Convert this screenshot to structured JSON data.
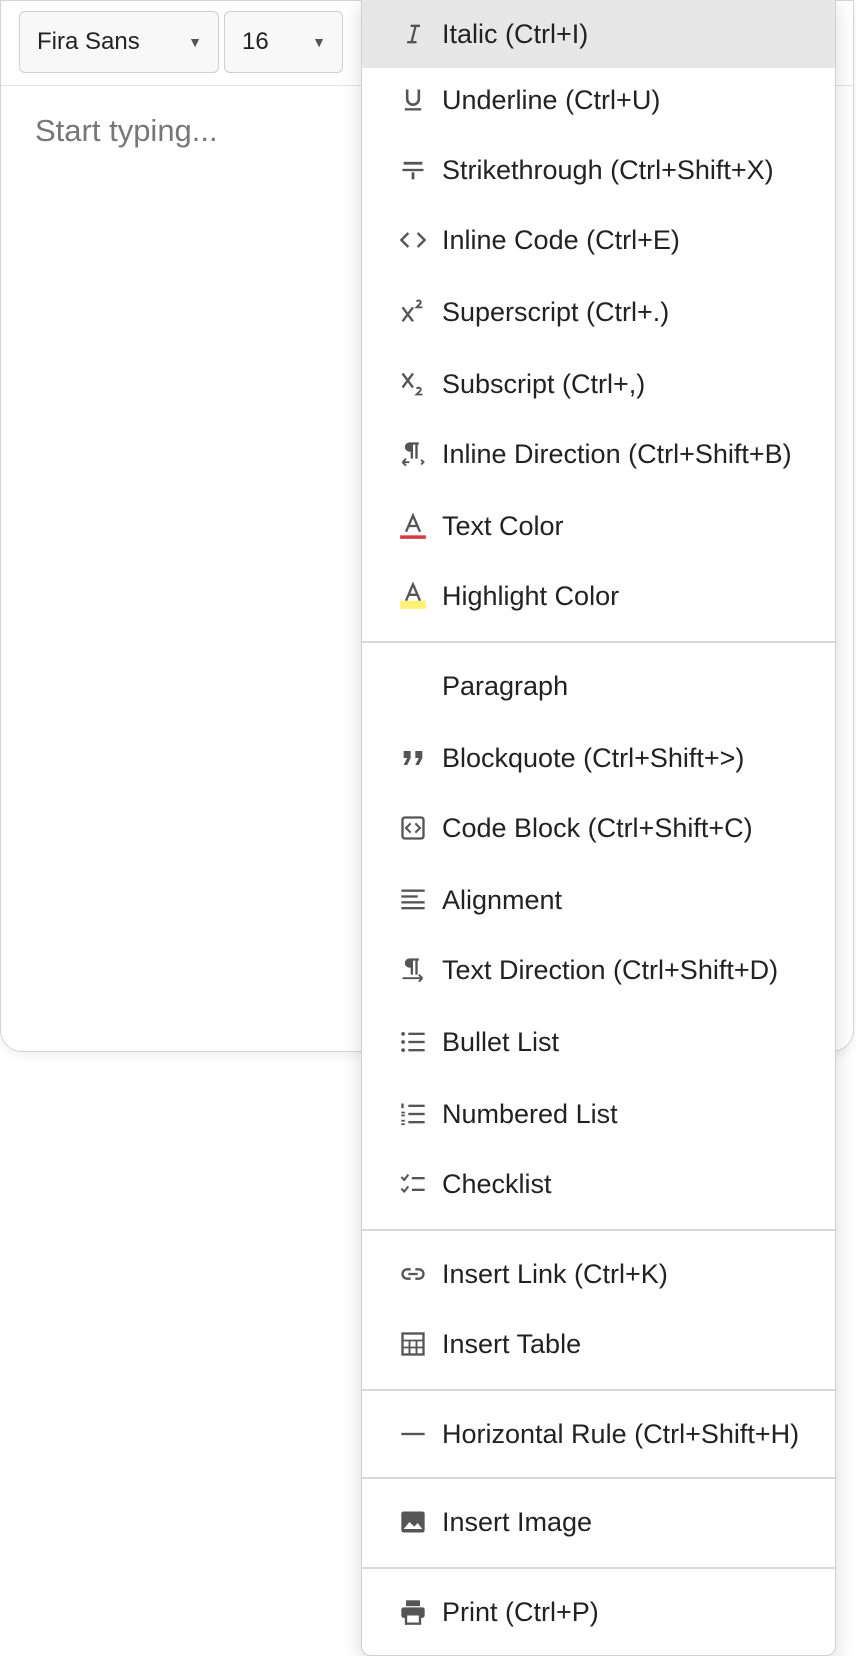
{
  "toolbar": {
    "font_family": "Fira Sans",
    "font_size": "16"
  },
  "editor": {
    "placeholder": "Start typing..."
  },
  "colors": {
    "text_color_indicator": "#d9363e",
    "highlight_color_indicator": "#fff176",
    "icon": "#555555",
    "active_item_bg": "#e7e7e7"
  },
  "menu": {
    "items": [
      {
        "label": "Italic (Ctrl+I)",
        "icon": "italic-icon"
      },
      {
        "label": "Underline (Ctrl+U)",
        "icon": "underline-icon"
      },
      {
        "label": "Strikethrough (Ctrl+Shift+X)",
        "icon": "strikethrough-icon"
      },
      {
        "label": "Inline Code (Ctrl+E)",
        "icon": "code-icon"
      },
      {
        "label": "Superscript (Ctrl+.)",
        "icon": "superscript-icon"
      },
      {
        "label": "Subscript (Ctrl+,)",
        "icon": "subscript-icon"
      },
      {
        "label": "Inline Direction (Ctrl+Shift+B)",
        "icon": "inline-direction-icon"
      },
      {
        "label": "Text Color",
        "icon": "text-color-icon"
      },
      {
        "label": "Highlight Color",
        "icon": "highlight-color-icon"
      },
      {
        "label": "Paragraph",
        "icon": ""
      },
      {
        "label": "Blockquote (Ctrl+Shift+>)",
        "icon": "blockquote-icon"
      },
      {
        "label": "Code Block (Ctrl+Shift+C)",
        "icon": "code-block-icon"
      },
      {
        "label": "Alignment",
        "icon": "align-left-icon"
      },
      {
        "label": "Text Direction (Ctrl+Shift+D)",
        "icon": "text-direction-icon"
      },
      {
        "label": "Bullet List",
        "icon": "bullet-list-icon"
      },
      {
        "label": "Numbered List",
        "icon": "numbered-list-icon"
      },
      {
        "label": "Checklist",
        "icon": "checklist-icon"
      },
      {
        "label": "Insert Link (Ctrl+K)",
        "icon": "link-icon"
      },
      {
        "label": "Insert Table",
        "icon": "table-icon"
      },
      {
        "label": "Horizontal Rule (Ctrl+Shift+H)",
        "icon": "horizontal-rule-icon"
      },
      {
        "label": "Insert Image",
        "icon": "image-icon"
      },
      {
        "label": "Print (Ctrl+P)",
        "icon": "print-icon"
      }
    ]
  }
}
